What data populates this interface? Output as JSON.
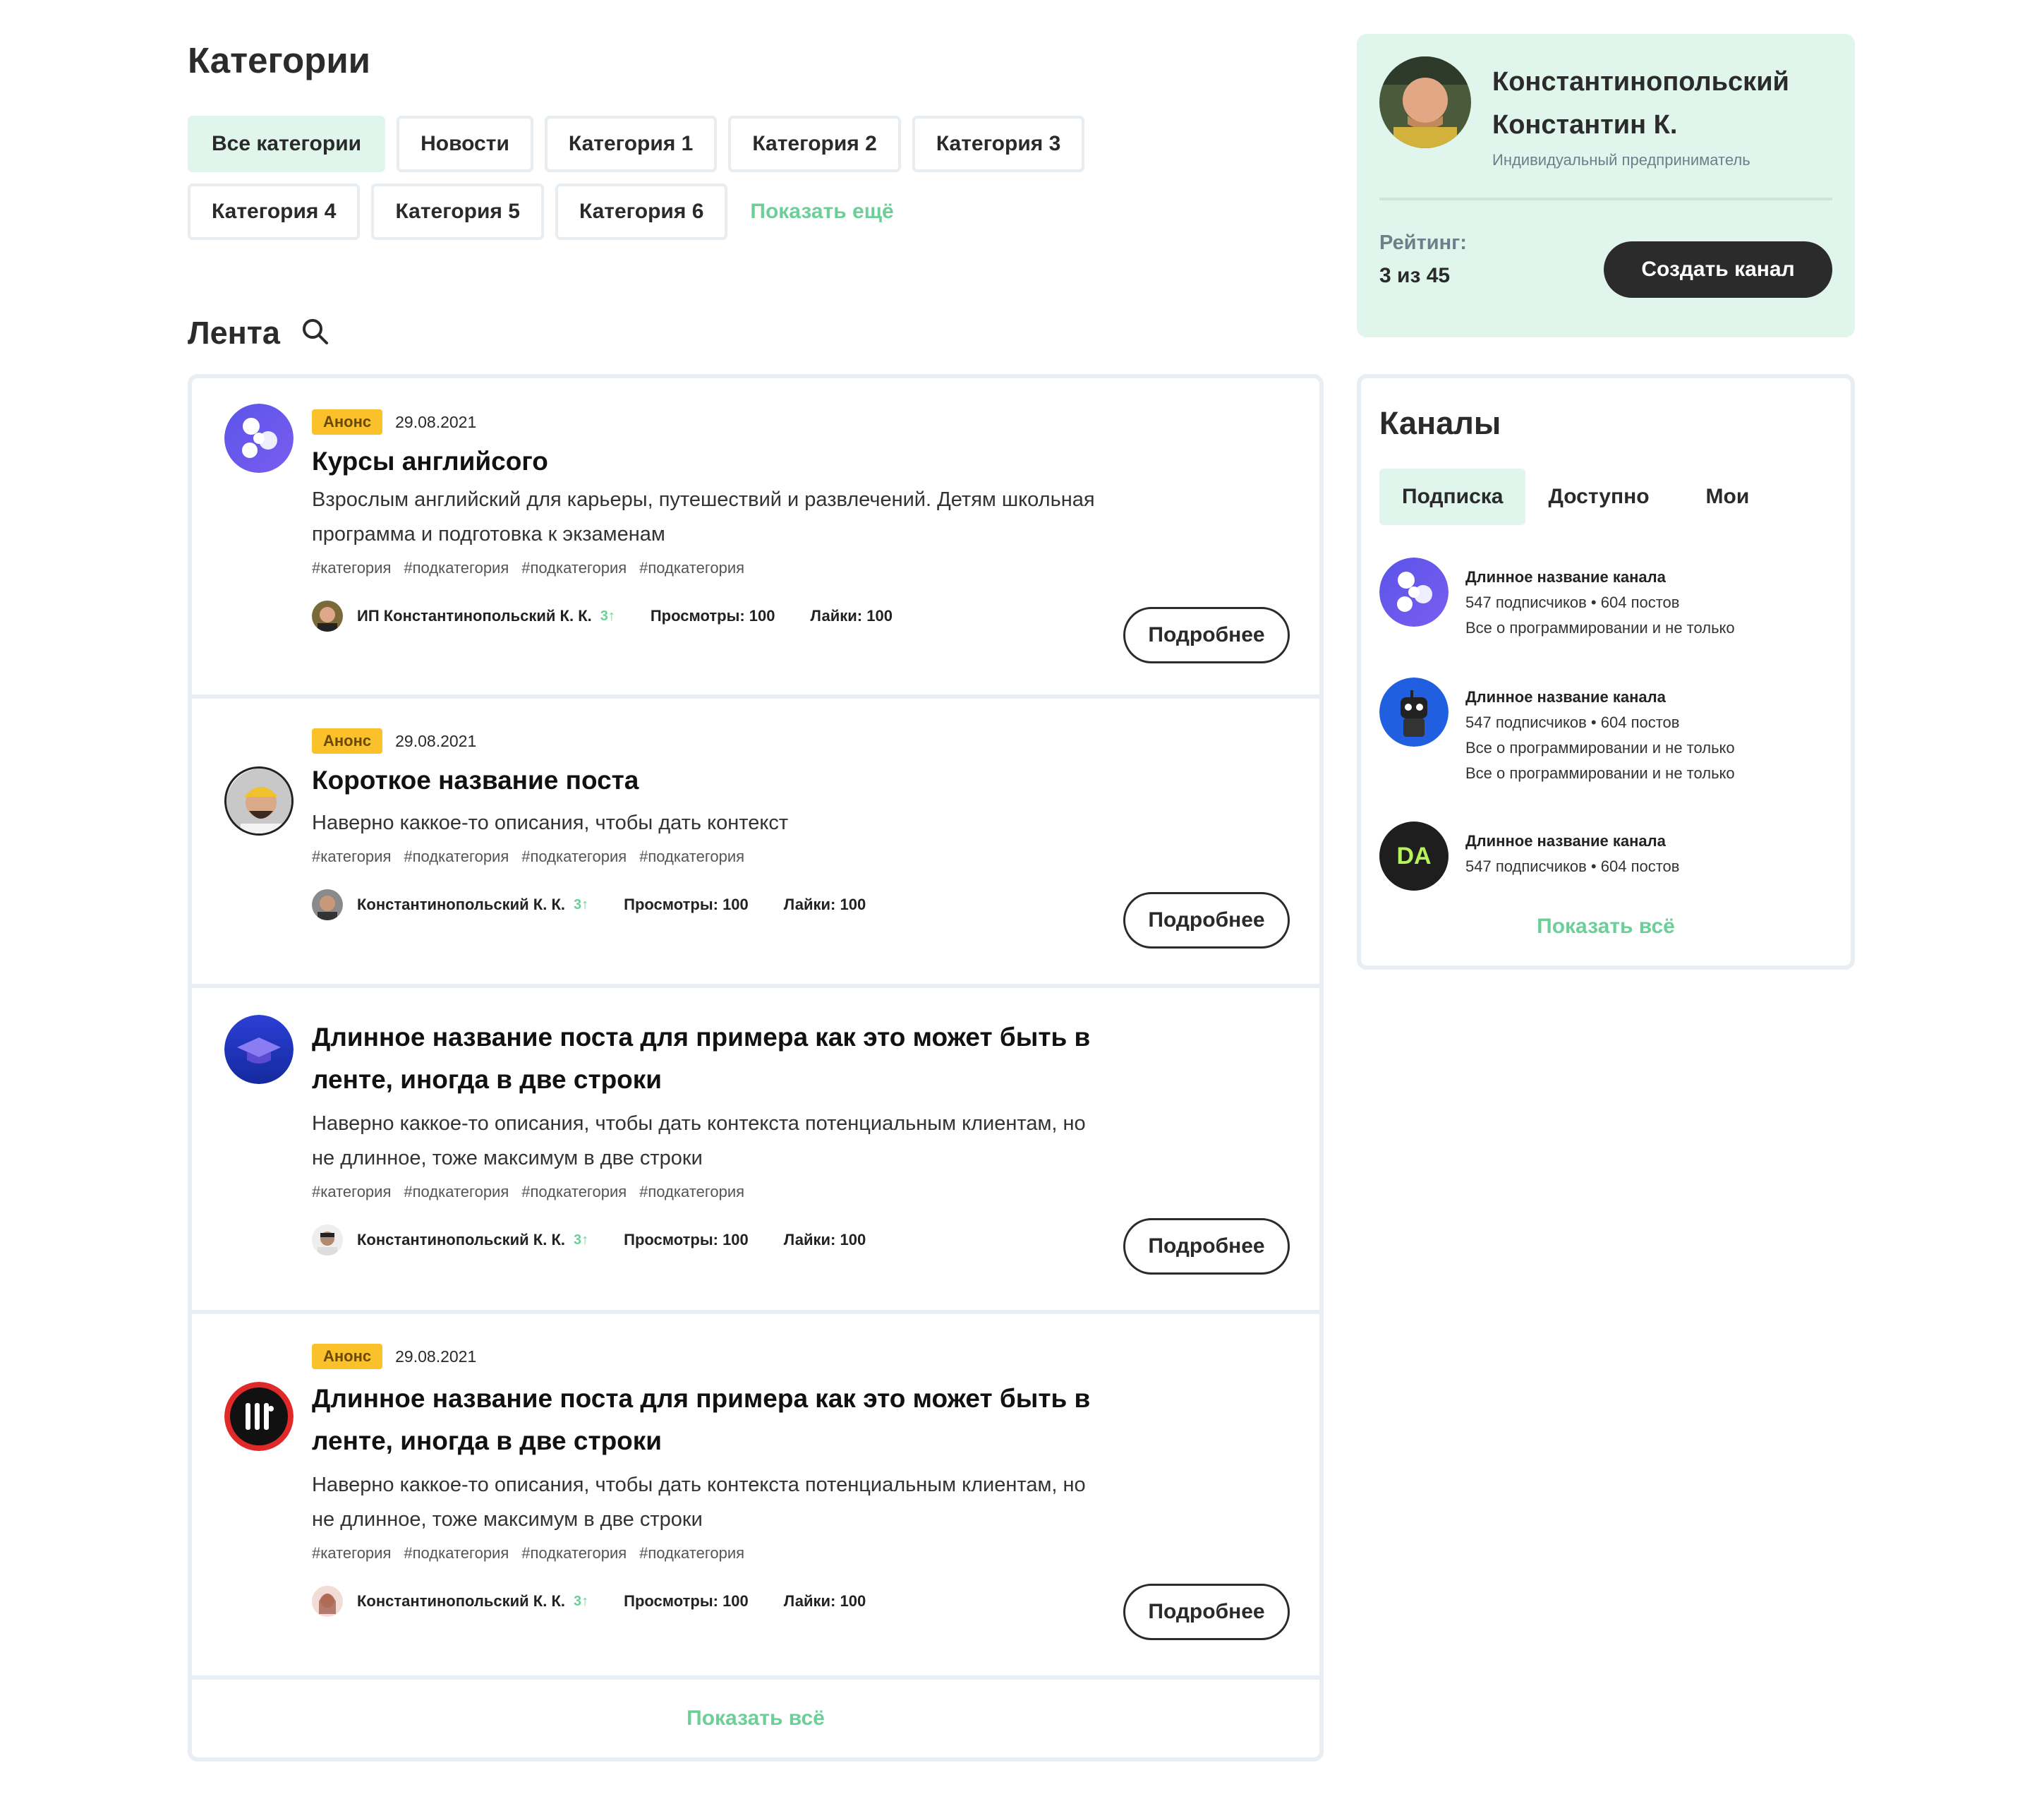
{
  "categories": {
    "title": "Категории",
    "chips": [
      "Все категории",
      "Новости",
      "Категория 1",
      "Категория 2",
      "Категория 3",
      "Категория 4",
      "Категория 5",
      "Категория 6"
    ],
    "show_more": "Показать ещё"
  },
  "feed": {
    "title": "Лента",
    "posts": [
      {
        "badge": "Анонс",
        "date": "29.08.2021",
        "title": "Курсы английсого",
        "desc": "Взрослым английский для карьеры, путешествий и развлечений. Детям школьная программа и подготовка к экзаменам",
        "tags": [
          "#категория",
          "#подкатегория",
          "#подкатегория",
          "#подкатегория"
        ],
        "author": "ИП Константинопольский К. К.",
        "rank": "3↑",
        "views": "Просмотры: 100",
        "likes": "Лайки: 100",
        "button": "Подробнее"
      },
      {
        "badge": "Анонс",
        "date": "29.08.2021",
        "title": "Короткое название поста",
        "desc": "Наверно каккое-то описания, чтобы дать контекст",
        "tags": [
          "#категория",
          "#подкатегория",
          "#подкатегория",
          "#подкатегория"
        ],
        "author": "Константинопольский К. К.",
        "rank": "3↑",
        "views": "Просмотры: 100",
        "likes": "Лайки: 100",
        "button": "Подробнее"
      },
      {
        "title": "Длинное название поста для примера как это может быть в ленте, иногда в две строки",
        "desc": "Наверно каккое-то описания, чтобы дать контекста потенциальным клиентам, но не длинное, тоже максимум в две строки",
        "tags": [
          "#категория",
          "#подкатегория",
          "#подкатегория",
          "#подкатегория"
        ],
        "author": "Константинопольский К. К.",
        "rank": "3↑",
        "views": "Просмотры: 100",
        "likes": "Лайки: 100",
        "button": "Подробнее"
      },
      {
        "badge": "Анонс",
        "date": "29.08.2021",
        "title": "Длинное название поста для примера как это может быть в ленте, иногда в две строки",
        "desc": "Наверно каккое-то описания, чтобы дать контекста потенциальным клиентам, но не длинное, тоже максимум в две строки",
        "tags": [
          "#категория",
          "#подкатегория",
          "#подкатегория",
          "#подкатегория"
        ],
        "author": "Константинопольский К. К.",
        "rank": "3↑",
        "views": "Просмотры: 100",
        "likes": "Лайки: 100",
        "button": "Подробнее"
      }
    ],
    "show_all": "Показать всё"
  },
  "profile": {
    "name": "Константинопольский Константин К.",
    "role": "Индивидуальный предприниматель",
    "rating_label": "Рейтинг:",
    "rating_value": "3 из 45",
    "create_button": "Создать канал"
  },
  "channels": {
    "title": "Каналы",
    "tabs": [
      "Подписка",
      "Доступно",
      "Мои"
    ],
    "items": [
      {
        "name": "Длинное название канала",
        "stats": "547 подписчиков • 604 постов",
        "lines": [
          "Все о программировании и не только"
        ]
      },
      {
        "name": "Длинное название канала",
        "stats": "547 подписчиков • 604 постов",
        "lines": [
          "Все о программировании и не только",
          "Все о программировании и не только"
        ]
      },
      {
        "name": "Длинное название канала",
        "stats": "547 подписчиков • 604 постов",
        "lines": [],
        "logo_text": "DA"
      }
    ],
    "show_all": "Показать всё"
  },
  "colors": {
    "accent": "#6dcf98",
    "accent_bg": "#e0f5eb",
    "badge": "#fbc12b",
    "dark": "#2b2b2b",
    "border": "#e8eef3"
  },
  "icons": [
    "search-icon",
    "swirl-logo-icon",
    "robot-logo-icon",
    "graduation-cap-icon",
    "bars-logo-icon",
    "da-logo-icon"
  ]
}
